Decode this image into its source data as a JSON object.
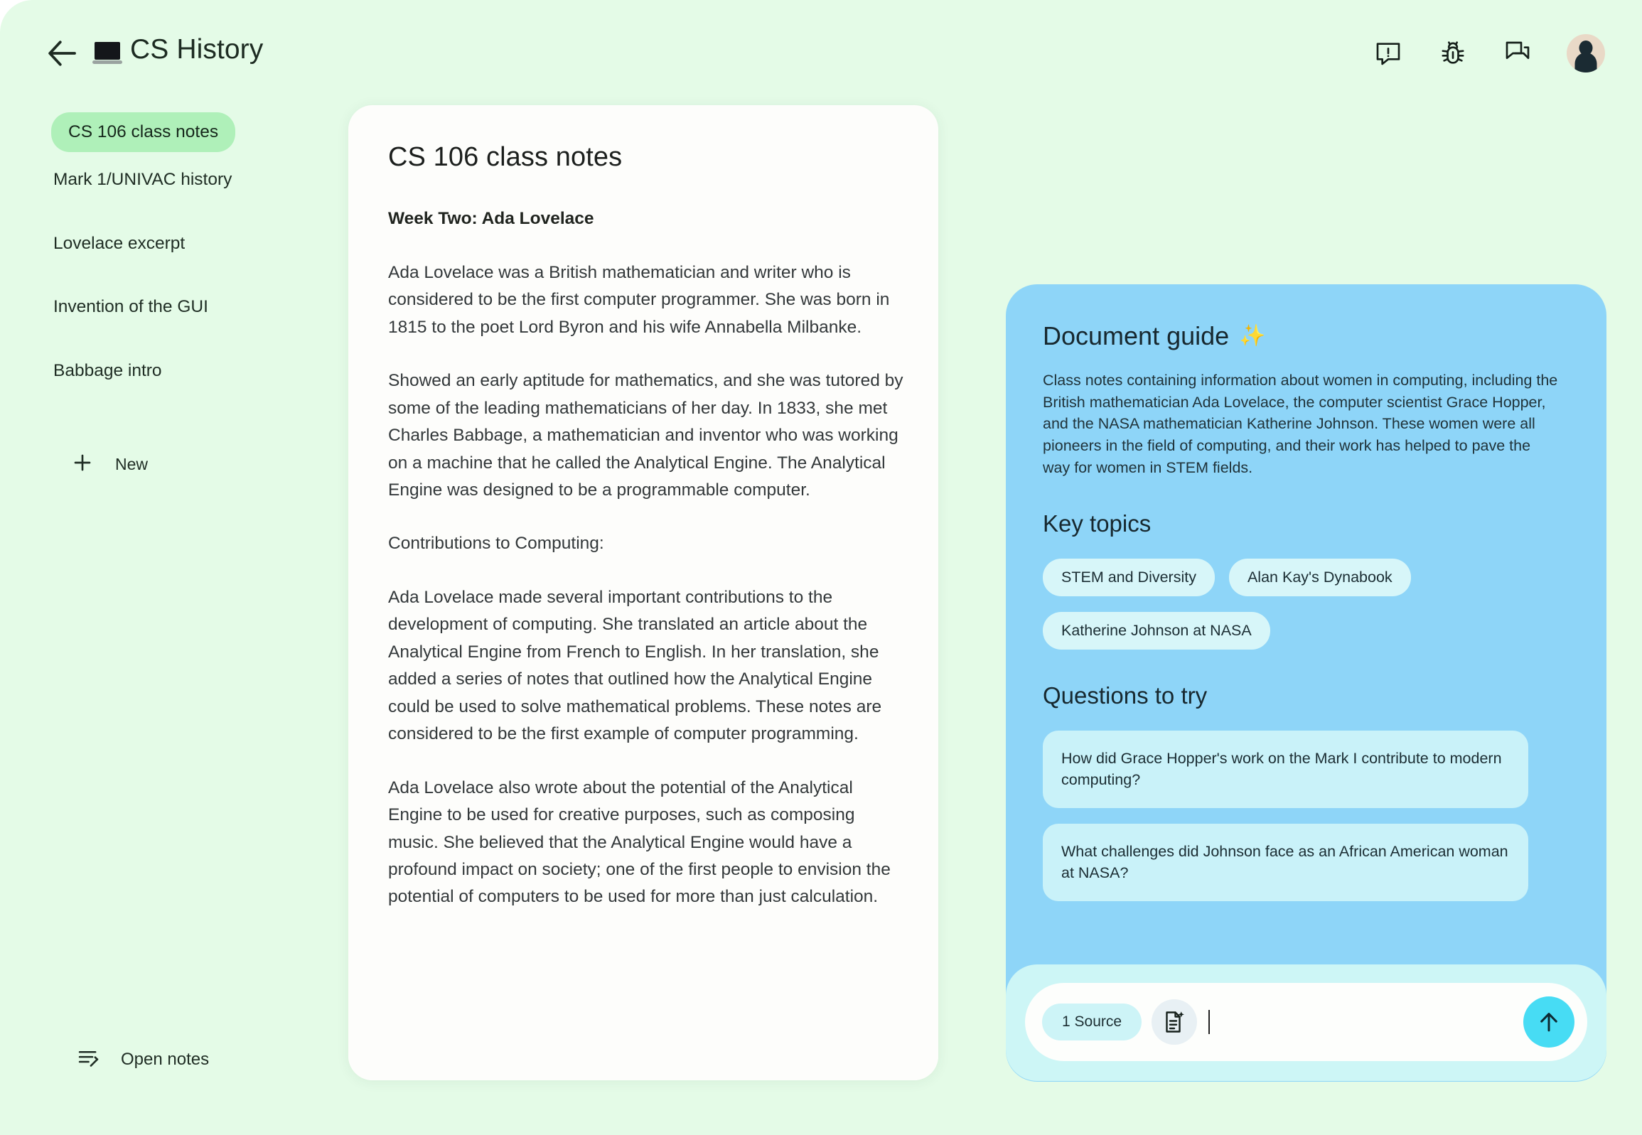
{
  "colors": {
    "app_background": "#e4fbe7",
    "sidebar_active": "#aff0b9",
    "guide_panel": "#8ed5f8",
    "chip": "#d7f6f9",
    "question_card": "#c9f2f9",
    "composer_shell": "#cdf6f6",
    "send_button": "#47dcf4",
    "doc_card": "#fdfdfb"
  },
  "header": {
    "back_label": "Back",
    "logo_name": "laptop-icon",
    "title": "CS History",
    "icons": [
      {
        "name": "feedback-icon",
        "label": "Send feedback"
      },
      {
        "name": "bug-report-icon",
        "label": "Report a bug"
      },
      {
        "name": "chat-icon",
        "label": "Chat"
      }
    ],
    "avatar_label": "Account"
  },
  "sidebar": {
    "items": [
      {
        "label": "CS 106 class notes",
        "active": true
      },
      {
        "label": "Mark 1/UNIVAC history",
        "active": false
      },
      {
        "label": "Lovelace excerpt",
        "active": false
      },
      {
        "label": "Invention of the GUI",
        "active": false
      },
      {
        "label": "Babbage intro",
        "active": false
      }
    ],
    "new_label": "New",
    "open_notes_label": "Open notes"
  },
  "document": {
    "title": "CS 106 class notes",
    "heading": "Week Two: Ada Lovelace",
    "paragraphs": [
      "Ada Lovelace was a British mathematician and writer who is considered to be the first computer programmer. She was born in 1815 to the poet Lord Byron and his wife Annabella Milbanke.",
      "Showed an early aptitude for mathematics, and she was tutored by some of the leading mathematicians of her day. In 1833, she met Charles Babbage, a mathematician and inventor who was working on a machine that he called the Analytical Engine. The Analytical Engine was designed to be a programmable computer.",
      "Contributions to Computing:",
      "Ada Lovelace made several important contributions to the development of computing. She translated an article about the Analytical Engine from French to English. In her translation, she added a series of notes that outlined how the Analytical Engine could be used to solve mathematical problems. These notes are considered to be the first example of computer programming.",
      "Ada Lovelace also wrote about the potential of the Analytical Engine to be used for creative purposes, such as composing music. She believed that the Analytical Engine would have a profound impact on society; one of the first people to envision the potential of computers to be used for more than just calculation."
    ]
  },
  "guide": {
    "title": "Document guide",
    "sparkle": "✨",
    "summary": "Class notes containing information about women in computing, including the British mathematician Ada Lovelace, the computer scientist Grace Hopper, and the NASA mathematician Katherine Johnson. These women were all pioneers in the field of computing, and their work has helped to pave the way for women in STEM fields.",
    "key_topics_title": "Key topics",
    "key_topics": [
      "STEM and Diversity",
      "Alan Kay's Dynabook",
      "Katherine Johnson at NASA"
    ],
    "questions_title": "Questions to try",
    "questions": [
      "How did Grace Hopper's work on the Mark I contribute to modern computing?",
      "What challenges did Johnson face as an African American woman at NASA?"
    ]
  },
  "composer": {
    "source_chip": "1 Source",
    "attach_icon": "document-sparkle-icon",
    "input_value": "",
    "input_placeholder": "",
    "send_icon": "arrow-up-icon"
  }
}
